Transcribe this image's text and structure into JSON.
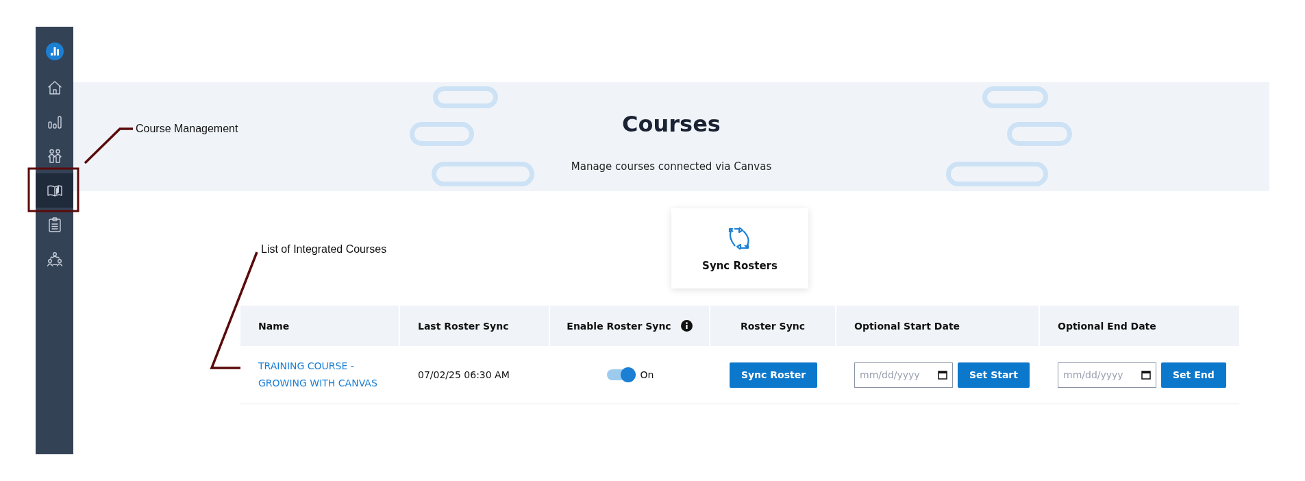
{
  "sidebar": {
    "items": [
      {
        "kind": "home",
        "selected": false
      },
      {
        "kind": "chart",
        "selected": false
      },
      {
        "kind": "people",
        "selected": false
      },
      {
        "kind": "book",
        "selected": true
      },
      {
        "kind": "clipboard",
        "selected": false
      },
      {
        "kind": "group",
        "selected": false
      }
    ]
  },
  "banner": {
    "title": "Courses",
    "subtitle": "Manage courses connected via Canvas"
  },
  "sync_card": {
    "label": "Sync Rosters"
  },
  "table": {
    "columns": [
      {
        "label": "Name",
        "info": false
      },
      {
        "label": "Last Roster Sync",
        "info": false
      },
      {
        "label": "Enable Roster Sync",
        "info": true
      },
      {
        "label": "Roster Sync",
        "info": false
      },
      {
        "label": "Optional Start Date",
        "info": false
      },
      {
        "label": "Optional End Date",
        "info": false
      }
    ],
    "rows": [
      {
        "name": "TRAINING COURSE - GROWING WITH CANVAS",
        "last_sync": "07/02/25 06:30 AM",
        "roster_sync": {
          "on": true,
          "label": "On"
        },
        "sync_button": "Sync Roster",
        "start_date": {
          "placeholder": "mm/dd/yyyy"
        },
        "start_button": "Set Start",
        "end_date": {
          "placeholder": "mm/dd/yyyy"
        },
        "end_button": "Set End"
      }
    ]
  },
  "annotations": [
    {
      "text": "Course Management"
    },
    {
      "text": "List of Integrated Courses"
    }
  ]
}
